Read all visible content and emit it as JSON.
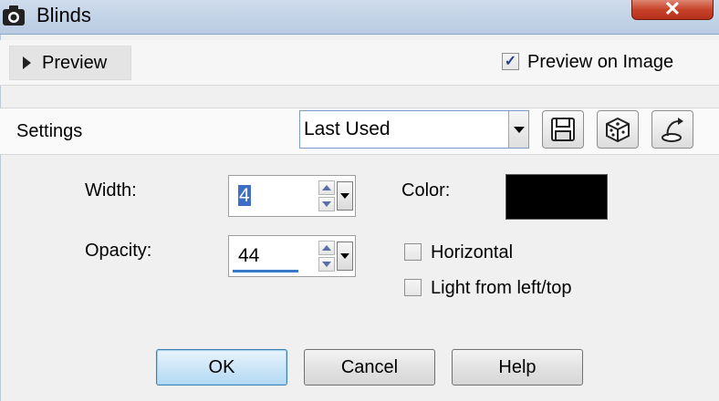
{
  "window": {
    "title": "Blinds",
    "close_glyph": "✕"
  },
  "preview": {
    "toggle_label": "Preview",
    "preview_on_image_label": "Preview on Image",
    "preview_on_image_checked": true
  },
  "settings": {
    "label": "Settings",
    "preset_value": "Last Used",
    "icons": [
      "save-preset-icon",
      "randomize-dice-icon",
      "reset-icon"
    ]
  },
  "fields": {
    "width_label": "Width:",
    "width_value": "4",
    "opacity_label": "Opacity:",
    "opacity_value": "44",
    "color_label": "Color:",
    "color_value": "#000000",
    "horizontal_label": "Horizontal",
    "horizontal_checked": false,
    "light_label": "Light from left/top",
    "light_checked": false
  },
  "buttons": {
    "ok": "OK",
    "cancel": "Cancel",
    "help": "Help"
  }
}
